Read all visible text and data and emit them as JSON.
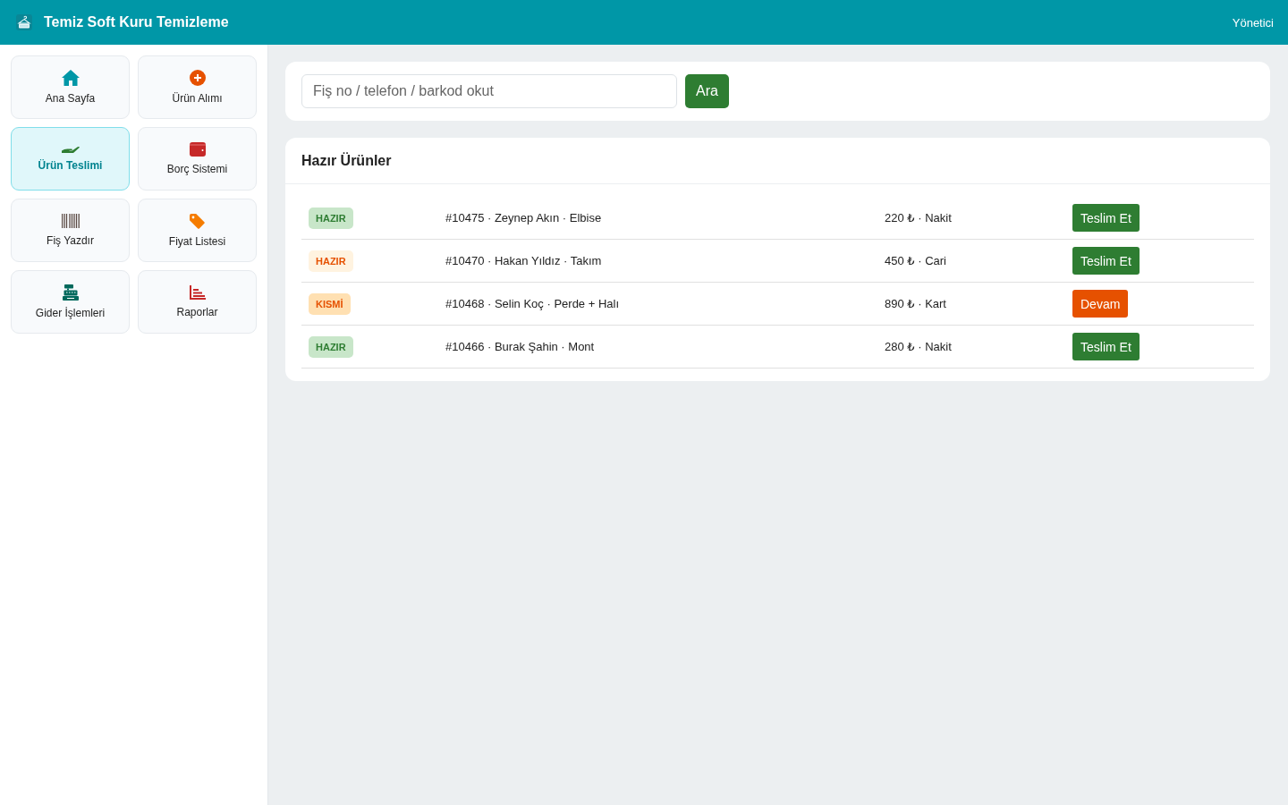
{
  "header": {
    "title": "Temiz Soft Kuru Temizleme",
    "user": "Yönetici"
  },
  "sidebar": {
    "items": [
      {
        "label": "Ana Sayfa",
        "selected": false
      },
      {
        "label": "Ürün Alımı",
        "selected": false
      },
      {
        "label": "Ürün Teslimi",
        "selected": true
      },
      {
        "label": "Borç Sistemi",
        "selected": false
      },
      {
        "label": "Fiş Yazdır",
        "selected": false
      },
      {
        "label": "Fiyat Listesi",
        "selected": false
      },
      {
        "label": "Gider İşlemleri",
        "selected": false
      },
      {
        "label": "Raporlar",
        "selected": false
      }
    ]
  },
  "search": {
    "placeholder": "Fiş no / telefon / barkod okut",
    "button": "Ara"
  },
  "ready_list": {
    "title": "Hazır Ürünler",
    "rows": [
      {
        "status": {
          "label": "HAZIR",
          "kind": "ready"
        },
        "summary": "#10475 · Zeynep Akın · Elbise",
        "payment": "220 ₺ · Nakit",
        "action": {
          "label": "Teslim Et",
          "kind": "deliver"
        }
      },
      {
        "status": {
          "label": "HAZIR",
          "kind": "pending"
        },
        "summary": "#10470 · Hakan Yıldız · Takım",
        "payment": "450 ₺ · Cari",
        "action": {
          "label": "Teslim Et",
          "kind": "deliver"
        }
      },
      {
        "status": {
          "label": "KISMİ",
          "kind": "partial"
        },
        "summary": "#10468 · Selin Koç · Perde + Halı",
        "payment": "890 ₺ · Kart",
        "action": {
          "label": "Devam",
          "kind": "continue"
        }
      },
      {
        "status": {
          "label": "HAZIR",
          "kind": "ready"
        },
        "summary": "#10466 · Burak Şahin · Mont",
        "payment": "280 ₺ · Nakit",
        "action": {
          "label": "Teslim Et",
          "kind": "deliver"
        }
      }
    ]
  }
}
